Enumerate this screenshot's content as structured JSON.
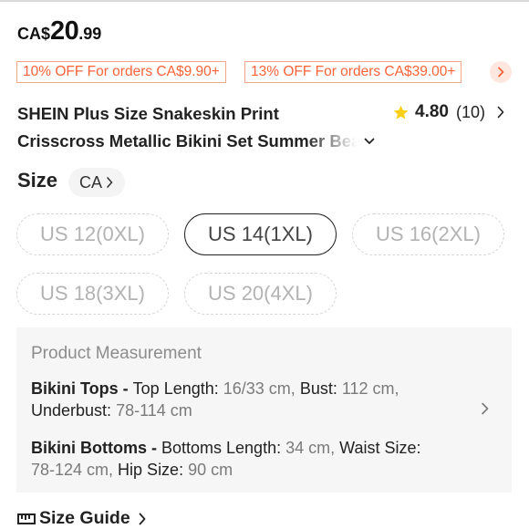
{
  "price": {
    "currency": "CA$",
    "integer": "20",
    "decimal": ".99"
  },
  "coupons": [
    "10% OFF For orders CA$9.90+",
    "13% OFF For orders CA$39.00+"
  ],
  "product": {
    "title_line1": "SHEIN Plus Size Snakeskin Print",
    "title_line2": "Crisscross Metallic Bikini Set Summer Beach"
  },
  "rating": {
    "score": "4.80",
    "count": "(10)"
  },
  "size": {
    "label": "Size",
    "region": "CA",
    "options": [
      {
        "label": "US 12(0XL)",
        "state": "disabled"
      },
      {
        "label": "US 14(1XL)",
        "state": "selected"
      },
      {
        "label": "US 16(2XL)",
        "state": "disabled"
      },
      {
        "label": "US 18(3XL)",
        "state": "disabled"
      },
      {
        "label": "US 20(4XL)",
        "state": "disabled"
      }
    ]
  },
  "measurement": {
    "title": "Product Measurement",
    "tops": {
      "name": "Bikini Tops - ",
      "k1": "Top Length: ",
      "v1": "16/33 cm, ",
      "k2": "Bust: ",
      "v2": "112 cm,",
      "k3": "Underbust: ",
      "v3": "78-114 cm"
    },
    "bottoms": {
      "name": "Bikini Bottoms - ",
      "k1": "Bottoms Length: ",
      "v1": "34 cm, ",
      "k2": "Waist Size: ",
      "v2": "78-124 cm, ",
      "k3": "Hip Size: ",
      "v3": "90 cm"
    }
  },
  "size_guide": {
    "label": "Size Guide"
  },
  "icons": {
    "star": "star-icon",
    "chevron": "chevron-right-icon",
    "chevron_down": "chevron-down-icon",
    "ruler": "ruler-icon"
  },
  "colors": {
    "accent": "#fa6338",
    "coupon_border": "#f0a887",
    "star": "#facf19"
  }
}
